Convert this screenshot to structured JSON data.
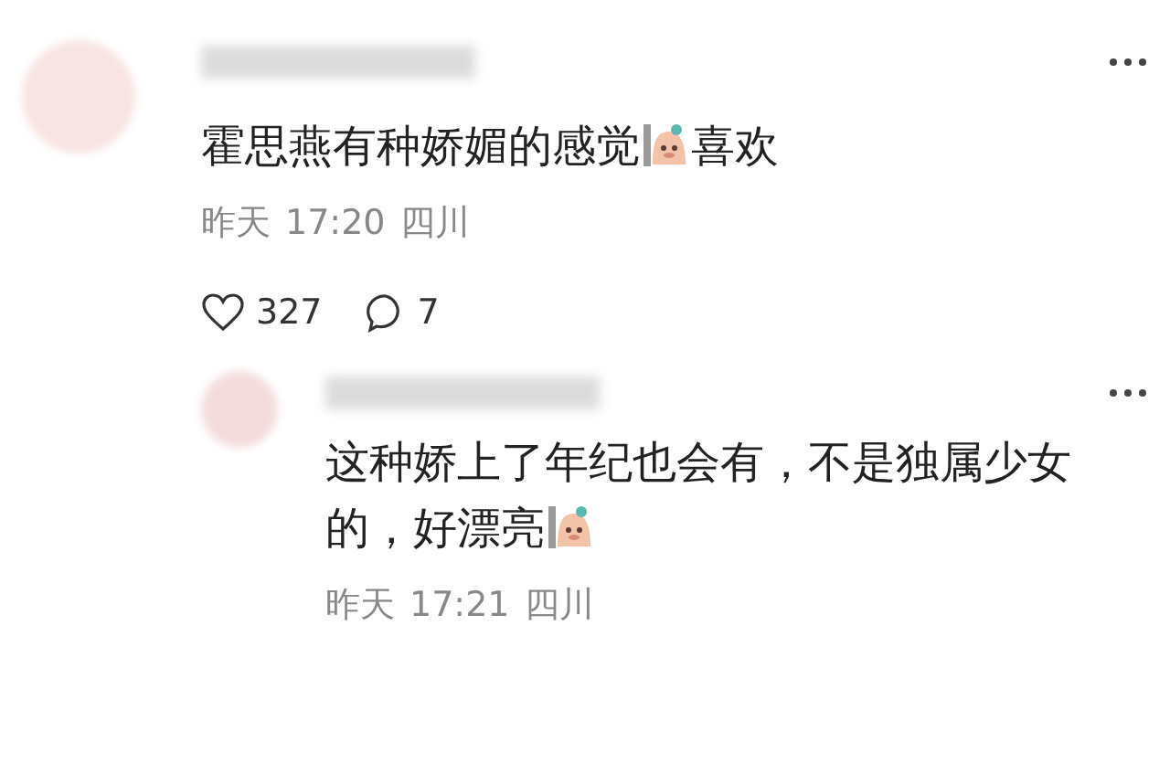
{
  "comments": [
    {
      "content": [
        {
          "kind": "text",
          "text": "霍思燕有种娇媚的感觉"
        },
        {
          "kind": "sticker"
        },
        {
          "kind": "text",
          "text": "喜欢"
        }
      ],
      "date": "昨天",
      "time": "17:20",
      "location": "四川",
      "likes": "327",
      "replies": "7"
    },
    {
      "content": [
        {
          "kind": "text",
          "text": "这种娇上了年纪也会有，不是独属少女的，好漂亮"
        },
        {
          "kind": "sticker"
        }
      ],
      "date": "昨天",
      "time": "17:21",
      "location": "四川"
    }
  ]
}
